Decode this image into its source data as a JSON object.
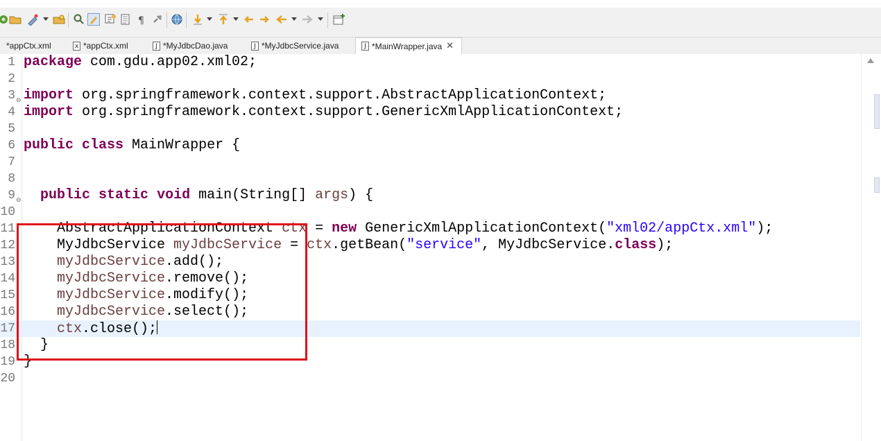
{
  "toolbar": {
    "icons": [
      "debug-icon",
      "open-folder-icon",
      "run-icon",
      "dropdown",
      "open-task-icon",
      "search-icon",
      "mark-occurrences-icon",
      "toggle-block-icon",
      "toggle-breadcrumb-icon",
      "show-whitespace-icon",
      "pin-icon",
      "globe-icon",
      "next-annotation-icon",
      "dropdown",
      "prev-annotation-icon",
      "dropdown",
      "last-edit-icon",
      "back-icon",
      "dropdown",
      "forward-icon",
      "dropdown",
      "new-view-icon"
    ]
  },
  "tabs": [
    {
      "label": "*appCtx.xml",
      "icon": "xml-file-icon",
      "active": false
    },
    {
      "label": "*appCtx.xml",
      "icon": "xml-file-icon",
      "active": false
    },
    {
      "label": "*MyJdbcDao.java",
      "icon": "java-file-icon",
      "active": false
    },
    {
      "label": "*MyJdbcService.java",
      "icon": "java-file-icon",
      "active": false
    },
    {
      "label": "*MainWrapper.java",
      "icon": "java-file-icon",
      "active": true
    }
  ],
  "close_glyph": "✕",
  "icon_letters": {
    "xml": "x",
    "java": "J"
  },
  "editor": {
    "lines": [
      {
        "n": "1",
        "p": [
          [
            "package",
            "kw"
          ],
          [
            " com.gdu.app02.xml02;",
            ""
          ]
        ]
      },
      {
        "n": "2",
        "p": []
      },
      {
        "n": "3",
        "fold": true,
        "p": [
          [
            "import",
            "kw"
          ],
          [
            " org.springframework.context.support.AbstractApplicationContext;",
            ""
          ]
        ]
      },
      {
        "n": "4",
        "p": [
          [
            "import",
            "kw"
          ],
          [
            " org.springframework.context.support.GenericXmlApplicationContext;",
            ""
          ]
        ]
      },
      {
        "n": "5",
        "p": []
      },
      {
        "n": "6",
        "p": [
          [
            "public",
            "kw"
          ],
          [
            " ",
            ""
          ],
          [
            "class",
            "kw"
          ],
          [
            " MainWrapper {",
            ""
          ]
        ]
      },
      {
        "n": "7",
        "p": []
      },
      {
        "n": "8",
        "p": []
      },
      {
        "n": "9",
        "fold": true,
        "p": [
          [
            "  ",
            ""
          ],
          [
            "public",
            "kw"
          ],
          [
            " ",
            ""
          ],
          [
            "static",
            "kw"
          ],
          [
            " ",
            ""
          ],
          [
            "void",
            "kw"
          ],
          [
            " main(String[] ",
            ""
          ],
          [
            "args",
            "var"
          ],
          [
            ") {",
            ""
          ]
        ]
      },
      {
        "n": "10",
        "p": []
      },
      {
        "n": "11",
        "p": [
          [
            "    AbstractApplicationContext ",
            ""
          ],
          [
            "ctx",
            "var"
          ],
          [
            " = ",
            ""
          ],
          [
            "new",
            "kw"
          ],
          [
            " GenericXmlApplicationContext(",
            ""
          ],
          [
            "\"xml02/appCtx.xml\"",
            "str"
          ],
          [
            ");",
            ""
          ]
        ]
      },
      {
        "n": "12",
        "p": [
          [
            "    MyJdbcService ",
            ""
          ],
          [
            "myJdbcService",
            "var"
          ],
          [
            " = ",
            ""
          ],
          [
            "ctx",
            "var"
          ],
          [
            ".getBean(",
            ""
          ],
          [
            "\"service\"",
            "str"
          ],
          [
            ", MyJdbcService.",
            ""
          ],
          [
            "class",
            "kw"
          ],
          [
            ");",
            ""
          ]
        ]
      },
      {
        "n": "13",
        "p": [
          [
            "    ",
            ""
          ],
          [
            "myJdbcService",
            "var"
          ],
          [
            ".add();",
            ""
          ]
        ]
      },
      {
        "n": "14",
        "p": [
          [
            "    ",
            ""
          ],
          [
            "myJdbcService",
            "var"
          ],
          [
            ".remove();",
            ""
          ]
        ]
      },
      {
        "n": "15",
        "p": [
          [
            "    ",
            ""
          ],
          [
            "myJdbcService",
            "var"
          ],
          [
            ".modify();",
            ""
          ]
        ]
      },
      {
        "n": "16",
        "p": [
          [
            "    ",
            ""
          ],
          [
            "myJdbcService",
            "var"
          ],
          [
            ".select();",
            ""
          ]
        ]
      },
      {
        "n": "17",
        "current": true,
        "cursor": true,
        "p": [
          [
            "    ",
            ""
          ],
          [
            "ctx",
            "var"
          ],
          [
            ".close();",
            ""
          ]
        ]
      },
      {
        "n": "18",
        "p": [
          [
            "  }",
            ""
          ]
        ]
      },
      {
        "n": "19",
        "p": [
          [
            "}",
            ""
          ]
        ]
      },
      {
        "n": "20",
        "p": []
      }
    ]
  },
  "colors": {
    "keyword": "#7f0055",
    "string": "#2a00ff",
    "local_variable": "#6a3e3e",
    "current_line": "#e8f2fe",
    "annotation_box": "#e0111a"
  }
}
